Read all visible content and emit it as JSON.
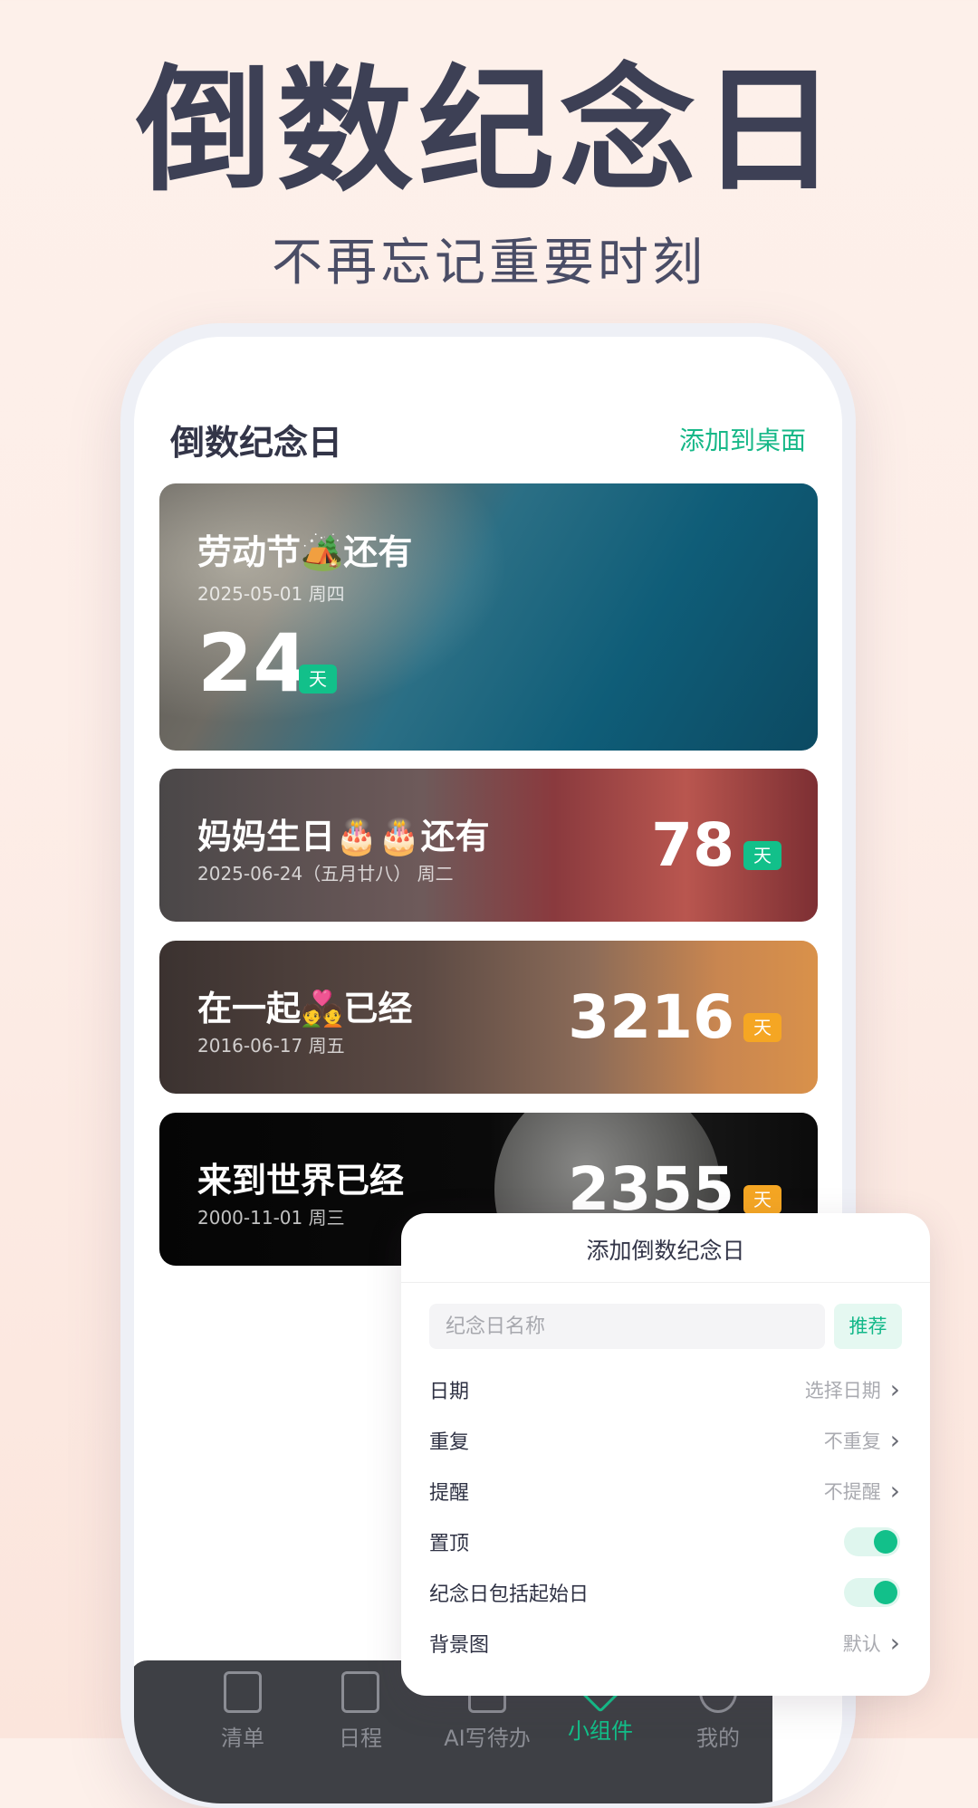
{
  "hero": {
    "title": "倒数纪念日",
    "subtitle": "不再忘记重要时刻"
  },
  "app": {
    "title": "倒数纪念日",
    "add_to_desktop": "添加到桌面"
  },
  "cards": [
    {
      "name": "劳动节🏕️还有",
      "date": "2025-05-01   周四",
      "days": "24",
      "unit": "天",
      "badge_color": "#12c08a"
    },
    {
      "name": "妈妈生日🎂🎂还有",
      "date": "2025-06-24（五月廿八）   周二",
      "days": "78",
      "unit": "天",
      "badge_color": "#12c08a"
    },
    {
      "name": "在一起💑已经",
      "date": "2016-06-17   周五",
      "days": "3216",
      "unit": "天",
      "badge_color": "#f5a623"
    },
    {
      "name": "来到世界已经",
      "date": "2000-11-01   周三",
      "days": "2355",
      "unit": "天",
      "badge_color": "#f5a623"
    }
  ],
  "tabbar": {
    "items": [
      {
        "label": "清单",
        "icon": "list-icon"
      },
      {
        "label": "日程",
        "icon": "calendar-icon"
      },
      {
        "label": "AI写待办",
        "icon": "ai-icon"
      },
      {
        "label": "小组件",
        "icon": "widget-icon",
        "active": true
      },
      {
        "label": "我的",
        "icon": "profile-icon"
      }
    ]
  },
  "sheet": {
    "title": "添加倒数纪念日",
    "name_placeholder": "纪念日名称",
    "recommend": "推荐",
    "rows": {
      "date": {
        "label": "日期",
        "value": "选择日期"
      },
      "repeat": {
        "label": "重复",
        "value": "不重复"
      },
      "remind": {
        "label": "提醒",
        "value": "不提醒"
      },
      "pin": {
        "label": "置顶",
        "on": true
      },
      "include_start": {
        "label": "纪念日包括起始日",
        "on": true
      },
      "background": {
        "label": "背景图",
        "value": "默认"
      }
    }
  },
  "colors": {
    "accent": "#12c08a",
    "orange": "#f5a623",
    "title": "#3d4055"
  }
}
